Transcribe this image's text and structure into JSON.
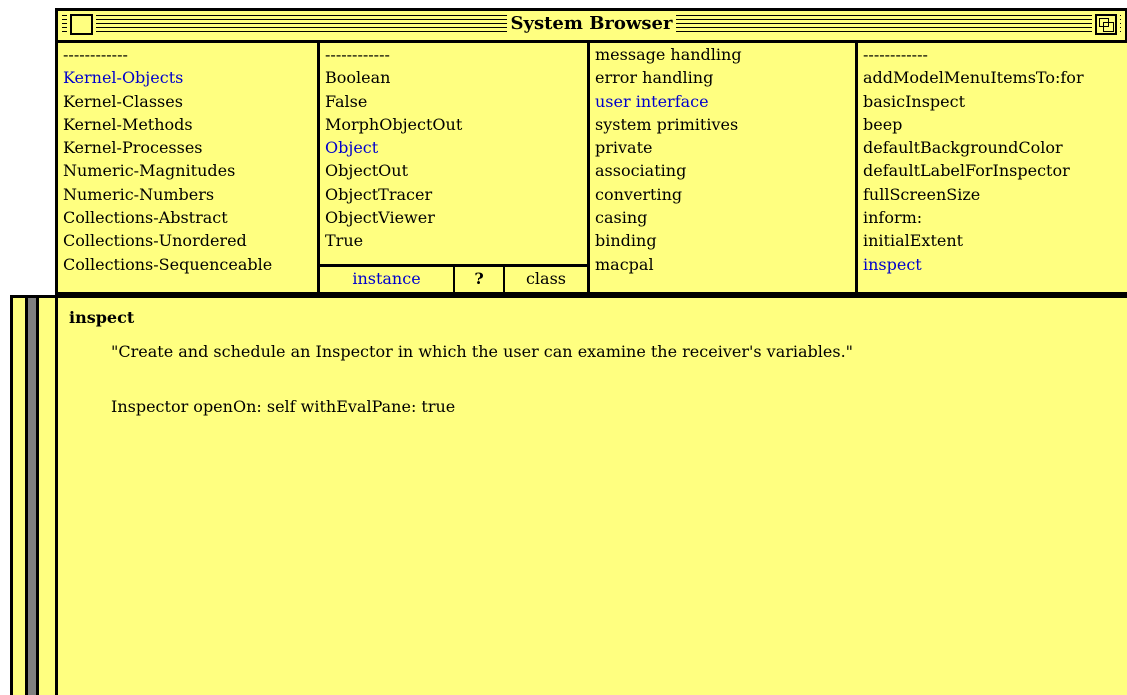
{
  "window": {
    "title": "System Browser"
  },
  "categories": {
    "items": [
      {
        "label": "------------",
        "selected": false
      },
      {
        "label": "Kernel-Objects",
        "selected": true
      },
      {
        "label": "Kernel-Classes",
        "selected": false
      },
      {
        "label": "Kernel-Methods",
        "selected": false
      },
      {
        "label": "Kernel-Processes",
        "selected": false
      },
      {
        "label": "Numeric-Magnitudes",
        "selected": false
      },
      {
        "label": "Numeric-Numbers",
        "selected": false
      },
      {
        "label": "Collections-Abstract",
        "selected": false
      },
      {
        "label": "Collections-Unordered",
        "selected": false
      },
      {
        "label": "Collections-Sequenceable",
        "selected": false
      }
    ]
  },
  "classes": {
    "items": [
      {
        "label": "------------",
        "selected": false
      },
      {
        "label": "Boolean",
        "selected": false
      },
      {
        "label": "False",
        "selected": false
      },
      {
        "label": "MorphObjectOut",
        "selected": false
      },
      {
        "label": "Object",
        "selected": true
      },
      {
        "label": "ObjectOut",
        "selected": false
      },
      {
        "label": "ObjectTracer",
        "selected": false
      },
      {
        "label": "ObjectViewer",
        "selected": false
      },
      {
        "label": "True",
        "selected": false
      }
    ],
    "switch": {
      "instance_label": "instance",
      "help_label": "?",
      "class_label": "class"
    }
  },
  "protocols": {
    "items": [
      {
        "label": "message handling",
        "selected": false
      },
      {
        "label": "error handling",
        "selected": false
      },
      {
        "label": "user interface",
        "selected": true
      },
      {
        "label": "system primitives",
        "selected": false
      },
      {
        "label": "private",
        "selected": false
      },
      {
        "label": "associating",
        "selected": false
      },
      {
        "label": "converting",
        "selected": false
      },
      {
        "label": "casing",
        "selected": false
      },
      {
        "label": "binding",
        "selected": false
      },
      {
        "label": "macpal",
        "selected": false
      }
    ]
  },
  "messages": {
    "items": [
      {
        "label": "------------",
        "selected": false
      },
      {
        "label": "addModelMenuItemsTo:for",
        "selected": false
      },
      {
        "label": "basicInspect",
        "selected": false
      },
      {
        "label": "beep",
        "selected": false
      },
      {
        "label": "defaultBackgroundColor",
        "selected": false
      },
      {
        "label": "defaultLabelForInspector",
        "selected": false
      },
      {
        "label": "fullScreenSize",
        "selected": false
      },
      {
        "label": "inform:",
        "selected": false
      },
      {
        "label": "initialExtent",
        "selected": false
      },
      {
        "label": "inspect",
        "selected": true
      }
    ]
  },
  "code": {
    "method_name": "inspect",
    "comment": "\"Create and schedule an Inspector in which the user can examine the receiver's variables.\"",
    "body": "Inspector openOn: self withEvalPane: true"
  },
  "colors": {
    "pane_background": "#ffff80",
    "selection_text": "#0000cc",
    "scrollbar_track": "#808080"
  }
}
